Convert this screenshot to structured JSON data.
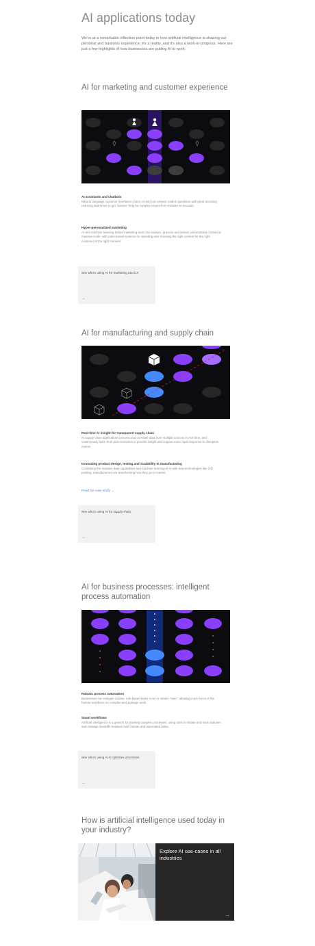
{
  "page": {
    "title": "AI applications today",
    "intro": "We're at a remarkable inflection point today in how artificial intelligence is shaping our personal and business experience: it's a reality, and it's also a work-in-progress. Here are just a few highlights of how businesses are putting AI to work:"
  },
  "marketing": {
    "heading": "AI for marketing and customer experience",
    "item1_title": "AI assistants and chatbots",
    "item1_text": "Natural language customer interfaces (voice or text) can answer routine questions with great accuracy reducing wait times to get \"human\" help for complex issues from minutes to seconds.",
    "item2_title": "Hyper-personalized marketing",
    "item2_text": "AI and machine learning-based marketing tools can analyze, process and deliver personalized content at massive scale, with rules-based systems for selecting and choosing the right content for the right customer at the right moment.",
    "card_text": "See who's using AI for marketing and CX",
    "card_arrow": "→"
  },
  "manufacturing": {
    "heading": "AI for manufacturing and supply chain",
    "item1_title": "Real-time AI insight for transparent supply chain",
    "item1_text": "AI supply chain applications process and correlate data from multiple sources in real time, and continuously learn from past scenarios to provide insight and support more rapid response to disruptive events.",
    "item2_title": "Innovating product design, testing and scalability in manufacturing",
    "item2_text": "Combining the massive data capabilities and machine learning of AI with new technologies like 3-D printing, manufacturers are transforming how they go to market.",
    "link_text": "Read the case study →",
    "card_text": "See who's using AI for supply chain",
    "card_arrow": "→"
  },
  "business": {
    "heading": "AI for business processes: intelligent process automation",
    "item1_title": "Robotic process automation",
    "item1_text": "Businesses can relegate routine, rule-based tasks to an AI robotic \"user\", allowing more focus of the human workforce on complex and strategic work.",
    "item2_title": "Smart workflows",
    "item2_text": "Artificial intelligence is a great fit for tracking complex processes, using rules to initiate and track statuses and manage handoffs between both human and automated tasks.",
    "card_text": "See who's using AI to optimize processes",
    "card_arrow": "→"
  },
  "industry": {
    "heading": "How is artificial intelligence used today in your industry?",
    "card_text": "Explore AI use-cases in all industries",
    "card_arrow": "→"
  },
  "colors": {
    "purple": "#8a3ffc",
    "blue": "#4589ff",
    "dark": "#0c0c10"
  }
}
